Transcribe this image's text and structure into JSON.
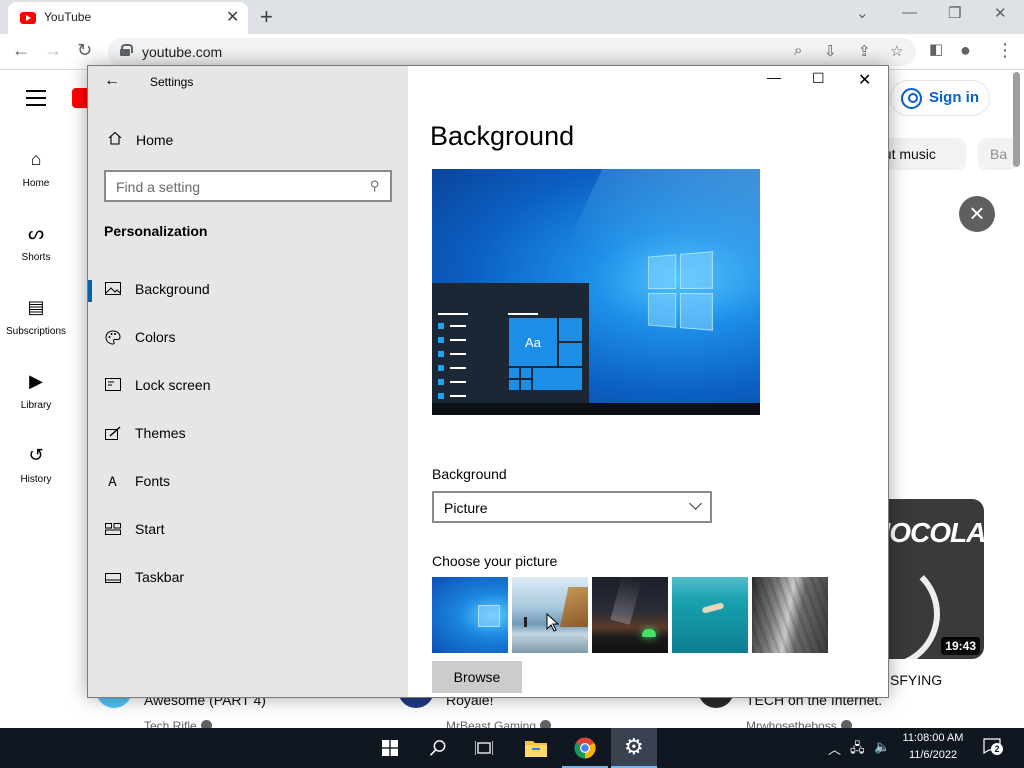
{
  "browser": {
    "tab_title": "YouTube",
    "url": "youtube.com"
  },
  "youtube": {
    "sidebar": [
      {
        "label": "Home",
        "icon": "home-icon"
      },
      {
        "label": "Shorts",
        "icon": "shorts-icon"
      },
      {
        "label": "Subscriptions",
        "icon": "subscriptions-icon"
      },
      {
        "label": "Library",
        "icon": "library-icon"
      },
      {
        "label": "History",
        "icon": "history-icon"
      }
    ],
    "sign_in_label": "Sign in",
    "chips": [
      "out music",
      "Ba"
    ],
    "thumb_word": "HOCOLATE",
    "thumb_duration": "19:43",
    "videos": [
      {
        "title": "Awesome (PART 4)",
        "channel": "Tech Rifle"
      },
      {
        "title": "Royale!",
        "channel": "MrBeast Gaming"
      },
      {
        "title": "TECH on the Internet.",
        "channel": "Mrwhosetheboss"
      }
    ],
    "partial_title": "SFYING"
  },
  "settings": {
    "app_title": "Settings",
    "home_label": "Home",
    "search_placeholder": "Find a setting",
    "section": "Personalization",
    "nav": [
      {
        "label": "Background",
        "icon": "picture-icon",
        "active": true
      },
      {
        "label": "Colors",
        "icon": "palette-icon",
        "active": false
      },
      {
        "label": "Lock screen",
        "icon": "lock-screen-icon",
        "active": false
      },
      {
        "label": "Themes",
        "icon": "themes-icon",
        "active": false
      },
      {
        "label": "Fonts",
        "icon": "fonts-icon",
        "active": false
      },
      {
        "label": "Start",
        "icon": "start-icon",
        "active": false
      },
      {
        "label": "Taskbar",
        "icon": "taskbar-icon",
        "active": false
      }
    ],
    "heading": "Background",
    "preview_tile_text": "Aa",
    "background_label": "Background",
    "background_value": "Picture",
    "choose_label": "Choose your picture",
    "browse_label": "Browse"
  },
  "taskbar": {
    "time": "11:08:00 AM",
    "date": "11/6/2022",
    "notification_count": "2"
  },
  "colors": {
    "accent": "#0063b1",
    "taskbar": "#101721",
    "settings_sidebar": "#e6e6e6",
    "youtube_red": "#ff0000"
  }
}
